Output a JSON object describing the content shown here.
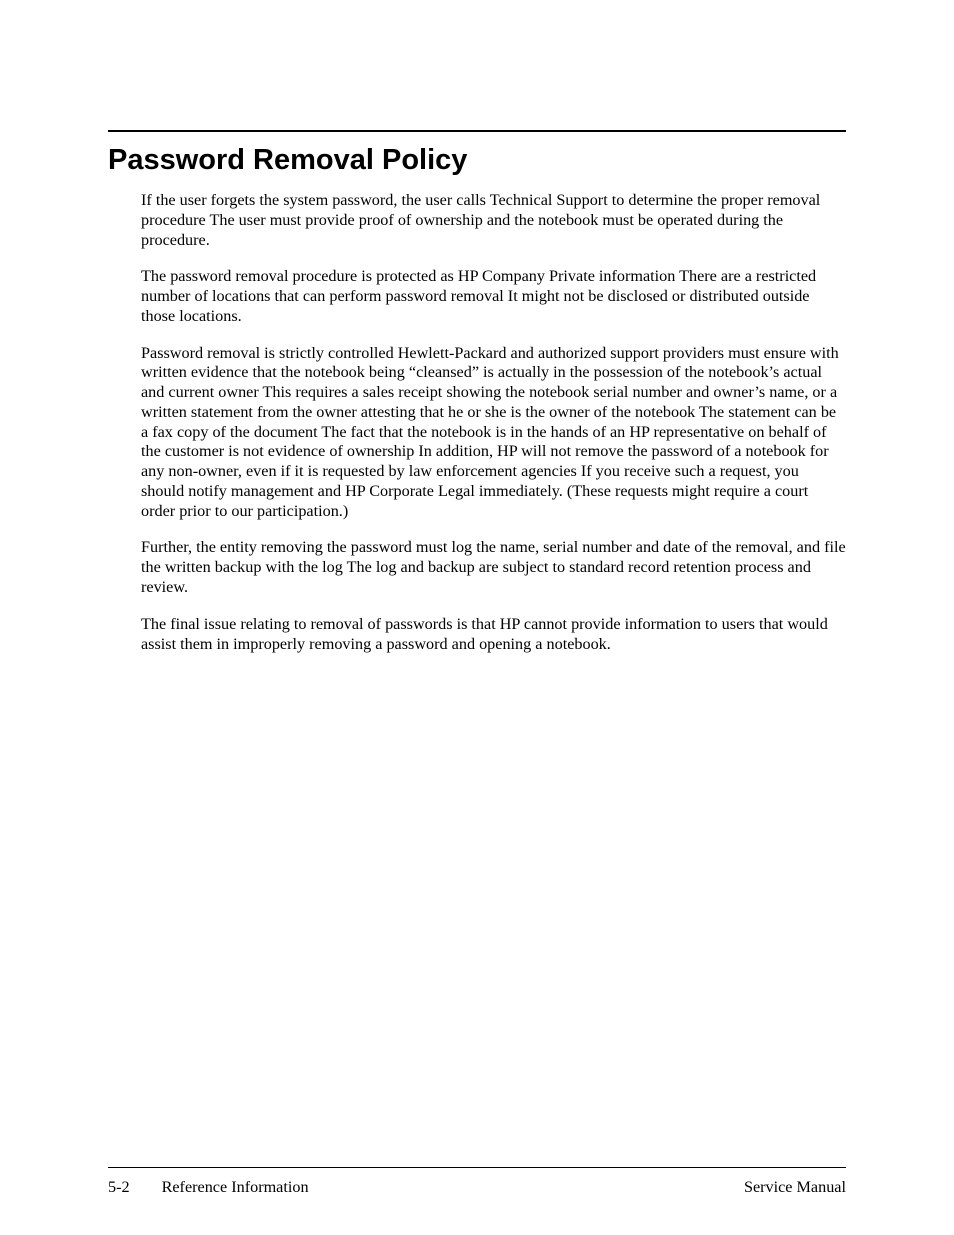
{
  "heading": "Password Removal Policy",
  "paragraphs": {
    "p1": "If the user forgets the system password, the user calls Technical Support to determine the proper removal procedure The user must provide proof of ownership and the notebook must be operated during the procedure.",
    "p2": "The password removal procedure is protected as HP Company Private information There are a restricted number of locations that can perform password removal It might not be disclosed or distributed outside those locations.",
    "p3": "Password removal is strictly controlled Hewlett-Packard and authorized support providers must ensure with written evidence that the notebook being “cleansed” is actually in the possession of the notebook’s actual and current owner This requires a sales receipt showing the notebook serial number and owner’s name, or a written statement from the owner attesting that he or she is the owner of the notebook The statement can be a fax copy of the document The fact that the notebook is in the hands of an HP representative on behalf of the customer is not evidence of ownership In addition, HP will not remove the password of a notebook for any non-owner, even if it is requested by law enforcement agencies If you receive such a request, you should notify management and HP Corporate Legal immediately. (These requests might require a court order prior to our participation.)",
    "p4": "Further, the entity removing the password must log the name, serial number and date of the removal, and file the written backup with the log The log and backup are subject to standard record retention process and review.",
    "p5": "The final issue relating to removal of passwords is that HP cannot provide information to users that would assist them in improperly removing a password and opening a notebook."
  },
  "footer": {
    "page_number": "5-2",
    "section": "Reference Information",
    "doc_title": "Service Manual"
  }
}
